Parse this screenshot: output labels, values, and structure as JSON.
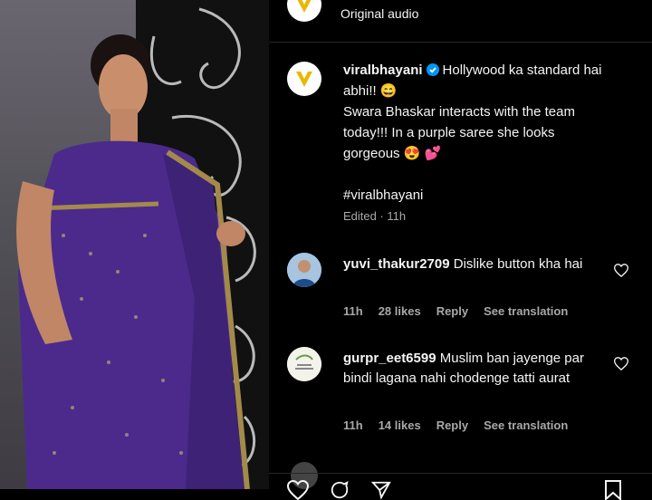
{
  "header": {
    "audio_label": "Original audio"
  },
  "post": {
    "username": "viralbhayani",
    "caption_line1": "Hollywood ka standard hai abhi!! 😄",
    "caption_line2": "Swara Bhaskar interacts with the team today!!! In a purple saree she looks gorgeous 😍 💕",
    "hashtag": "#viralbhayani",
    "edited_time": "Edited · 11h"
  },
  "comments": [
    {
      "username": "yuvi_thakur2709",
      "text": "Dislike button kha hai",
      "time": "11h",
      "likes": "28 likes",
      "reply": "Reply",
      "translate": "See translation"
    },
    {
      "username": "gurpr_eet6599",
      "text": "Muslim ban jayenge par bindi lagana nahi chodenge tatti aurat",
      "time": "11h",
      "likes": "14 likes",
      "reply": "Reply",
      "translate": "See translation"
    }
  ],
  "colors": {
    "background": "#000000",
    "text": "#f5f5f5",
    "muted": "#a8a8a8",
    "verified": "#0095f6",
    "saree": "#4b2a8c"
  }
}
